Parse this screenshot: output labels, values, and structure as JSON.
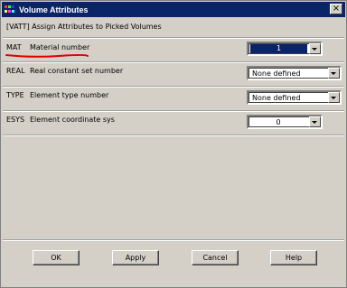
{
  "window": {
    "title": "Volume Attributes",
    "close_glyph": "×"
  },
  "header": {
    "subtitle": "[VATT]  Assign Attributes to Picked Volumes"
  },
  "rows": [
    {
      "code": "MAT",
      "label": "Material number",
      "value": "1"
    },
    {
      "code": "REAL",
      "label": "Real constant set number",
      "value": "None defined"
    },
    {
      "code": "TYPE",
      "label": "Element type number",
      "value": "None defined"
    },
    {
      "code": "ESYS",
      "label": "Element coordinate sys",
      "value": "0"
    }
  ],
  "buttons": {
    "ok": "OK",
    "apply": "Apply",
    "cancel": "Cancel",
    "help": "Help"
  },
  "colors": {
    "titlebar": "#0a246a",
    "annotation": "#e00000"
  },
  "icons": {
    "app": "ansys-app-icon",
    "close": "close-icon",
    "dropdown": "chevron-down-icon"
  }
}
